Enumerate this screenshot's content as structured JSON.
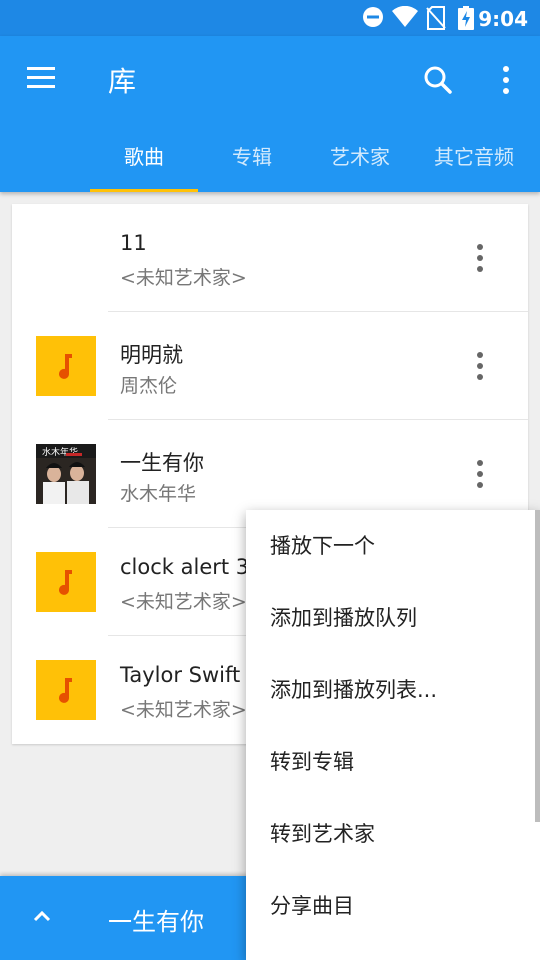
{
  "status_bar": {
    "time": "9:04",
    "icons": [
      "do-not-disturb-icon",
      "wifi-icon",
      "no-sim-icon",
      "battery-charging-icon"
    ]
  },
  "app_bar": {
    "title": "库",
    "icons": [
      "menu-icon",
      "search-icon",
      "more-vert-icon"
    ],
    "tab_indicator_color": "#ffc107",
    "tabs": [
      {
        "label": "歌曲",
        "active": true
      },
      {
        "label": "专辑",
        "active": false
      },
      {
        "label": "艺术家",
        "active": false
      },
      {
        "label": "其它音频",
        "active": false
      }
    ]
  },
  "songs": [
    {
      "title": "11",
      "artist": "<未知艺术家>",
      "art": "none"
    },
    {
      "title": "明明就",
      "artist": "周杰伦",
      "art": "music-note-icon"
    },
    {
      "title": "一生有你",
      "artist": "水木年华",
      "art": "album-cover",
      "cover_text": "水木年华"
    },
    {
      "title": "clock alert 3",
      "artist": "<未知艺术家>",
      "art": "music-note-icon"
    },
    {
      "title": "Taylor Swift",
      "artist": "<未知艺术家>",
      "art": "music-note-icon"
    }
  ],
  "context_menu": {
    "items": [
      {
        "label": "播放下一个"
      },
      {
        "label": "添加到播放队列"
      },
      {
        "label": "添加到播放列表..."
      },
      {
        "label": "转到专辑"
      },
      {
        "label": "转到艺术家"
      },
      {
        "label": "分享曲目"
      }
    ]
  },
  "now_playing": {
    "title": "一生有你",
    "icon": "chevron-up-icon"
  },
  "colors": {
    "primary": "#2196f3",
    "status_bar": "#1e88e5",
    "accent": "#ffc107",
    "note": "#e65100"
  }
}
